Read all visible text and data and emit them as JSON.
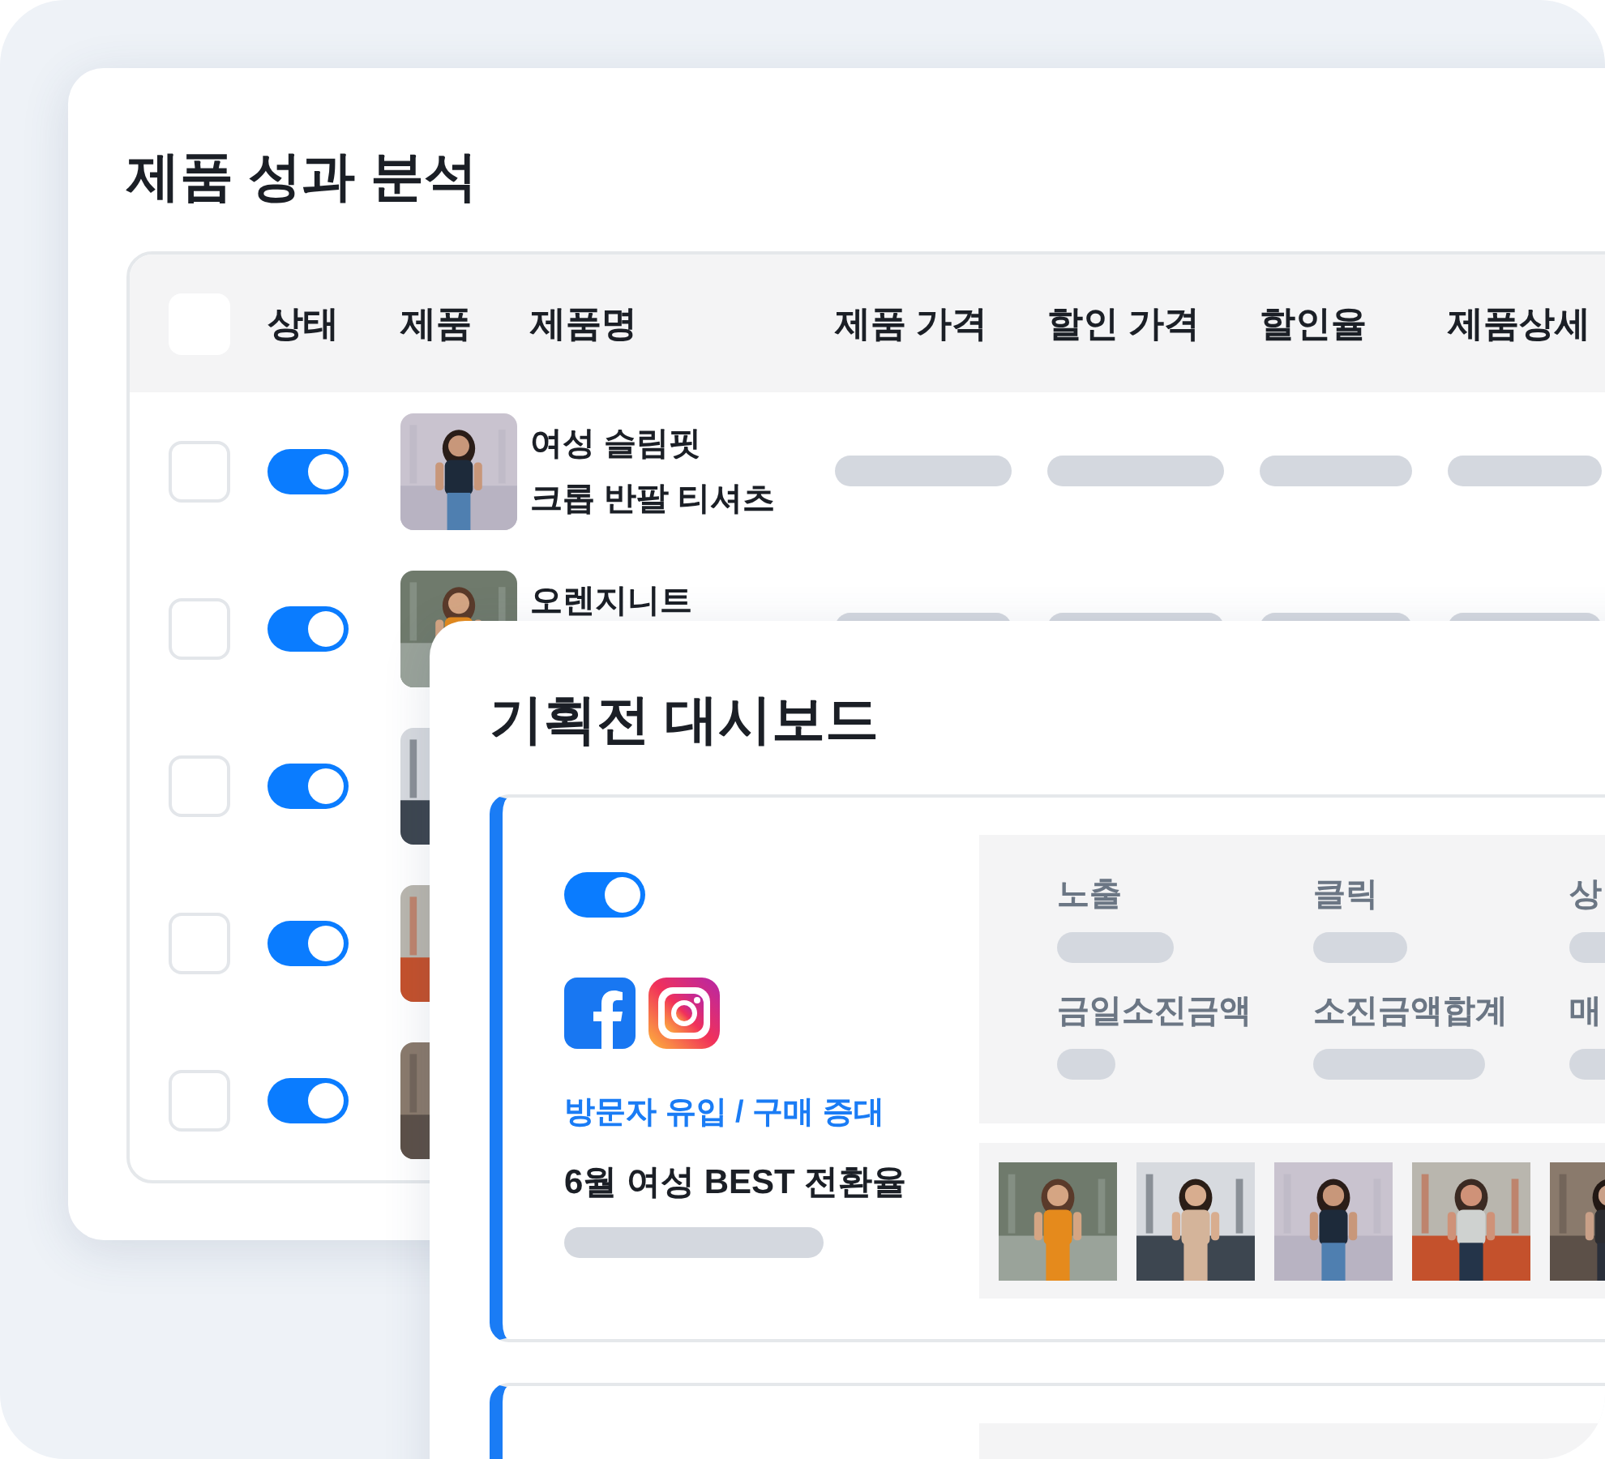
{
  "product_panel": {
    "title": "제품 성과 분석",
    "header_checkbox": {
      "checked": false
    },
    "columns": [
      "상태",
      "제품",
      "제품명",
      "제품 가격",
      "할인 가격",
      "할인율",
      "제품상세"
    ],
    "rows": [
      {
        "checked": false,
        "on": true,
        "image": {
          "kind": "picture"
        },
        "name": "여성 슬림핏\n크롭 반팔 티셔츠"
      },
      {
        "checked": false,
        "on": true,
        "image": {
          "kind": "picture"
        },
        "name": "오렌지니트"
      },
      {
        "checked": false,
        "on": true,
        "image": {
          "kind": "picture"
        }
      },
      {
        "checked": false,
        "on": true,
        "image": {
          "kind": "picture"
        }
      },
      {
        "checked": false,
        "on": true,
        "image": {
          "kind": "picture"
        }
      }
    ]
  },
  "dashboard_panel": {
    "title": "기획전 대시보드",
    "campaigns": [
      {
        "on": true,
        "goal": "방문자 유입 / 구매 증대",
        "name": "6월 여성 BEST 전환율",
        "metrics": [
          "노출",
          "클릭",
          "상",
          "금일소진금액",
          "소진금액합계",
          "매"
        ],
        "thumbnails": [
          {
            "kind": "picture"
          },
          {
            "kind": "picture"
          },
          {
            "kind": "picture"
          },
          {
            "kind": "picture"
          },
          {
            "kind": "picture"
          }
        ]
      }
    ]
  }
}
